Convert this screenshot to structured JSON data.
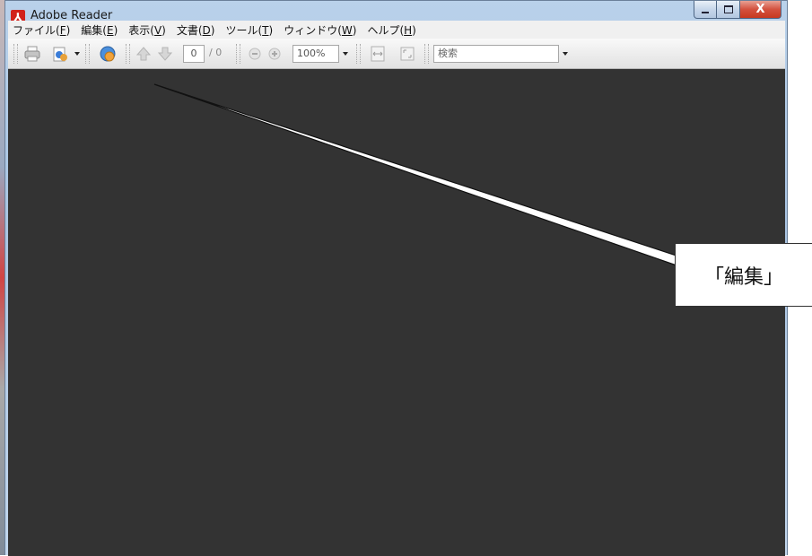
{
  "window": {
    "title": "Adobe Reader",
    "close_glyph": "X",
    "app_icon": "adobe-reader-icon"
  },
  "menubar": {
    "items": [
      {
        "label": "ファイル(",
        "key": "F",
        "tail": ")"
      },
      {
        "label": "編集(",
        "key": "E",
        "tail": ")"
      },
      {
        "label": "表示(",
        "key": "V",
        "tail": ")"
      },
      {
        "label": "文書(",
        "key": "D",
        "tail": ")"
      },
      {
        "label": "ツール(",
        "key": "T",
        "tail": ")"
      },
      {
        "label": "ウィンドウ(",
        "key": "W",
        "tail": ")"
      },
      {
        "label": "ヘルプ(",
        "key": "H",
        "tail": ")"
      }
    ]
  },
  "toolbar": {
    "page_current": "0",
    "page_total": "/ 0",
    "zoom": "100%",
    "search_placeholder": "検索",
    "icons": [
      "print-icon",
      "share-icon",
      "collaborate-icon",
      "prev-page-icon",
      "next-page-icon",
      "zoom-out-icon",
      "zoom-in-icon",
      "fit-width-icon",
      "full-screen-icon"
    ]
  },
  "annotation": {
    "callout_text": "「編集」"
  },
  "colors": {
    "content_bg": "#333333",
    "titlebar": "#b9d1ea",
    "close_button": "#c7381f"
  }
}
